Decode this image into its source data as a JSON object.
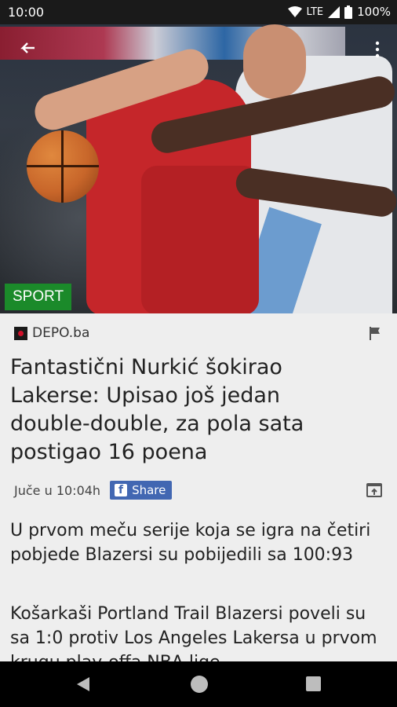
{
  "status_bar": {
    "time": "10:00",
    "network": "LTE",
    "battery": "100%",
    "icons": [
      "wifi-icon",
      "signal-icon",
      "battery-icon"
    ]
  },
  "hero": {
    "category_badge": "SPORT",
    "badge_color": "#1b8a2a"
  },
  "article": {
    "source_name": "DEPO.ba",
    "title": "Fantastični Nurkić šokirao Lakerse: Upisao još jedan double-double, za pola sata postigao 16 poena",
    "date": "Juče u 10:04h",
    "share_label": "Share",
    "lead": "U prvom meču serije koja se igra na četiri pobjede Blazersi su pobijedili sa 100:93",
    "body": "Košarkaši Portland Trail Blazersi poveli su sa 1:0 protiv Los Angeles Lakersa u prvom krugu play-offa NBA lige."
  },
  "colors": {
    "facebook": "#4267b2",
    "background": "#eeeeee"
  }
}
